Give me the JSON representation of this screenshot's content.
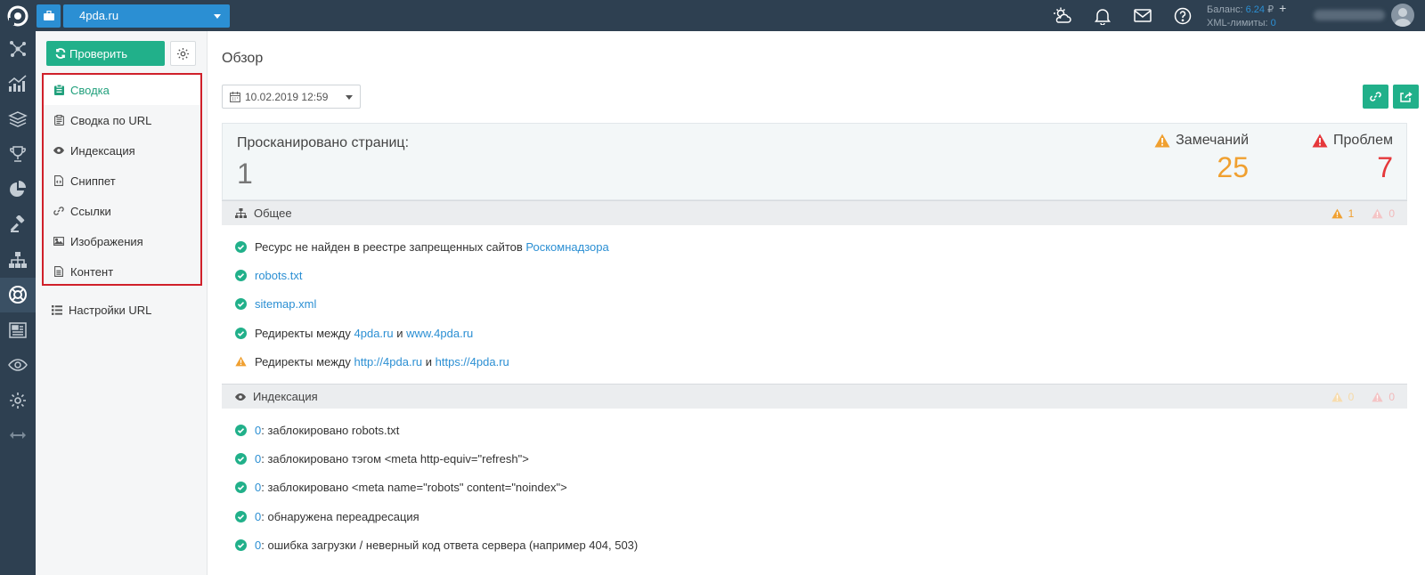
{
  "project": {
    "name": "4pda.ru"
  },
  "topbar": {
    "balance_label": "Баланс:",
    "balance_value": "6.24",
    "currency": "₽",
    "xml_label": "XML-лимиты:",
    "xml_value": "0",
    "icons": [
      "weather-icon",
      "bell-icon",
      "mail-icon",
      "help-icon"
    ]
  },
  "sidebar": {
    "check_label": "Проверить",
    "items": [
      {
        "label": "Сводка",
        "icon": "clipboard-icon",
        "active": true
      },
      {
        "label": "Сводка по URL",
        "icon": "clipboard-list-icon",
        "active": false
      },
      {
        "label": "Индексация",
        "icon": "eye-icon",
        "active": false
      },
      {
        "label": "Сниппет",
        "icon": "file-code-icon",
        "active": false
      },
      {
        "label": "Ссылки",
        "icon": "link-icon",
        "active": false
      },
      {
        "label": "Изображения",
        "icon": "image-icon",
        "active": false
      },
      {
        "label": "Контент",
        "icon": "file-text-icon",
        "active": false
      }
    ],
    "settings_label": "Настройки URL"
  },
  "main": {
    "title": "Обзор",
    "date": "10.02.2019 12:59",
    "summary": {
      "scanned_label": "Просканировано страниц:",
      "scanned_value": "1",
      "warnings_label": "Замечаний",
      "warnings_value": "25",
      "problems_label": "Проблем",
      "problems_value": "7"
    },
    "general": {
      "title": "Общее",
      "warn_count": "1",
      "err_count": "0",
      "row1_text": "Ресурс не найден в реестре запрещенных сайтов ",
      "row1_link": "Роскомнадзора",
      "row2_link": "robots.txt",
      "row3_link": "sitemap.xml",
      "row4_text": "Редиректы между ",
      "row4_link1": "4pda.ru",
      "row4_and": " и ",
      "row4_link2": "www.4pda.ru",
      "row5_text": "Редиректы между ",
      "row5_link1": "http://4pda.ru",
      "row5_and": " и ",
      "row5_link2": "https://4pda.ru"
    },
    "indexing": {
      "title": "Индексация",
      "warn_count": "0",
      "err_count": "0",
      "rows": [
        {
          "count": "0",
          "text": ": заблокировано robots.txt"
        },
        {
          "count": "0",
          "text": ": заблокировано тэгом <meta http-equiv=\"refresh\">"
        },
        {
          "count": "0",
          "text": ": заблокировано <meta name=\"robots\" content=\"noindex\">"
        },
        {
          "count": "0",
          "text": ": обнаружена переадресация"
        },
        {
          "count": "0",
          "text": ": ошибка загрузки / неверный код ответа сервера (например 404, 503)"
        }
      ]
    }
  },
  "colors": {
    "accent": "#21b08a",
    "link": "#2b8fd3",
    "warning": "#f0a030",
    "danger": "#e5383b",
    "nav_border": "#d0202a",
    "topbar": "#2e4051"
  }
}
